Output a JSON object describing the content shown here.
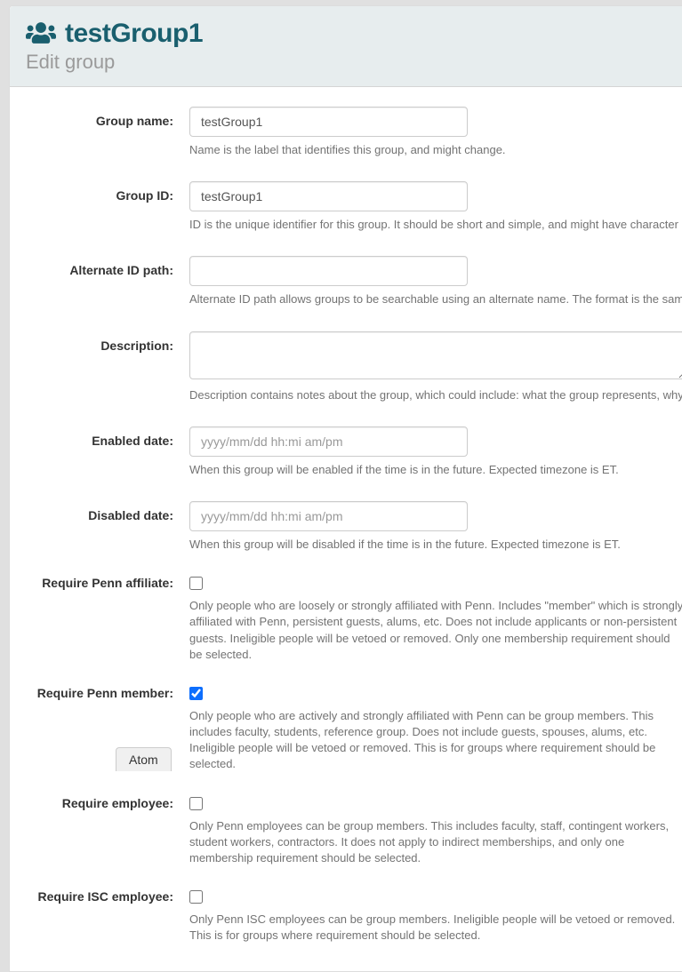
{
  "header": {
    "title": "testGroup1",
    "subtitle": "Edit group"
  },
  "fields": {
    "groupName": {
      "label": "Group name:",
      "value": "testGroup1",
      "help": "Name is the label that identifies this group, and might change."
    },
    "groupId": {
      "label": "Group ID:",
      "value": "testGroup1",
      "help": "ID is the unique identifier for this group. It should be short and simple, and might have character restrictions. The ID"
    },
    "altIdPath": {
      "label": "Alternate ID path:",
      "value": "",
      "help": "Alternate ID path allows groups to be searchable using an alternate name. The format is the same as the format of"
    },
    "description": {
      "label": "Description:",
      "value": "",
      "help": "Description contains notes about the group, which could include: what the group represents, why it was created, e"
    },
    "enabledDate": {
      "label": "Enabled date:",
      "value": "",
      "placeholder": "yyyy/mm/dd hh:mi am/pm",
      "help": "When this group will be enabled if the time is in the future. Expected timezone is ET."
    },
    "disabledDate": {
      "label": "Disabled date:",
      "value": "",
      "placeholder": "yyyy/mm/dd hh:mi am/pm",
      "help": "When this group will be disabled if the time is in the future. Expected timezone is ET."
    },
    "requirePennAffiliate": {
      "label": "Require Penn affiliate:",
      "checked": false,
      "help": "Only people who are loosely or strongly affiliated with Penn. Includes \"member\" which is strongly affiliated with Penn, persistent guests, alums, etc. Does not include applicants or non-persistent guests. Ineligible people will be vetoed or removed. Only one membership requirement should be selected."
    },
    "requirePennMember": {
      "label": "Require Penn member:",
      "checked": true,
      "help": "Only people who are actively and strongly affiliated with Penn can be group members. This includes faculty, students, reference group. Does not include guests, spouses, alums, etc. Ineligible people will be vetoed or removed. This is for groups where requirement should be selected."
    },
    "requireEmployee": {
      "label": "Require employee:",
      "checked": false,
      "help": "Only Penn employees can be group members. This includes faculty, staff, contingent workers, student workers, contractors. It does not apply to indirect memberships, and only one membership requirement should be selected."
    },
    "requireIscEmployee": {
      "label": "Require ISC employee:",
      "checked": false,
      "help": "Only Penn ISC employees can be group members. Ineligible people will be vetoed or removed. This is for groups where requirement should be selected."
    }
  },
  "atomButton": "Atom"
}
